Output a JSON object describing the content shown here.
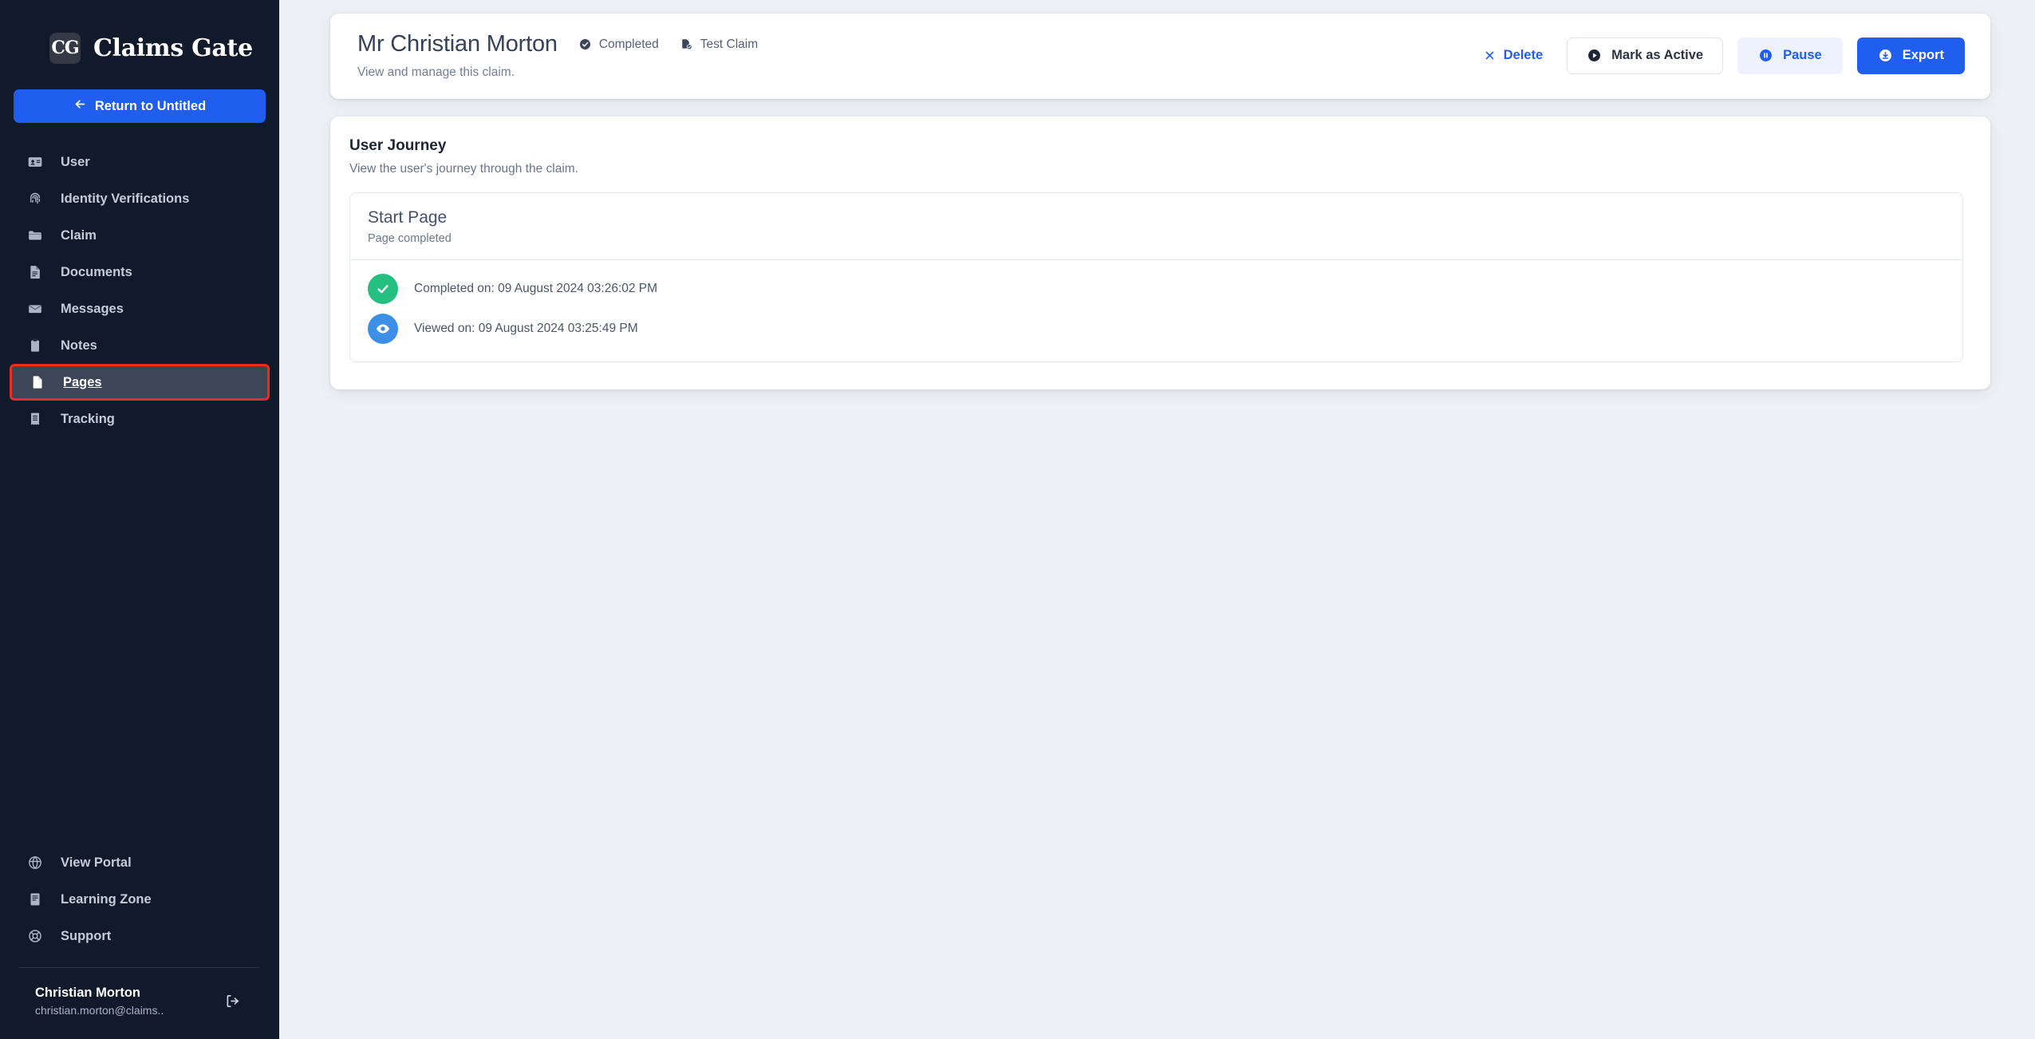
{
  "brand": {
    "logo_text": "CG",
    "name": "Claims Gate",
    "logo_icon": "claims-gate-monogram"
  },
  "sidebar": {
    "return_button": {
      "label": "Return to Untitled",
      "icon": "arrow-left-icon"
    },
    "items": [
      {
        "label": "User",
        "icon": "id-card-icon",
        "active": false
      },
      {
        "label": "Identity Verifications",
        "icon": "fingerprint-icon",
        "active": false
      },
      {
        "label": "Claim",
        "icon": "folder-icon",
        "active": false
      },
      {
        "label": "Documents",
        "icon": "document-text-icon",
        "active": false
      },
      {
        "label": "Messages",
        "icon": "envelope-icon",
        "active": false
      },
      {
        "label": "Notes",
        "icon": "clipboard-icon",
        "active": false
      },
      {
        "label": "Pages",
        "icon": "page-icon",
        "active": true
      },
      {
        "label": "Tracking",
        "icon": "receipt-icon",
        "active": false
      }
    ],
    "bottom_items": [
      {
        "label": "View Portal",
        "icon": "globe-icon"
      },
      {
        "label": "Learning Zone",
        "icon": "book-icon"
      },
      {
        "label": "Support",
        "icon": "lifebuoy-icon"
      }
    ],
    "user": {
      "name": "Christian Morton",
      "email": "christian.morton@claims..",
      "logout_icon": "logout-icon"
    }
  },
  "header": {
    "title": "Mr Christian Morton",
    "subtitle": "View and manage this claim.",
    "badges": [
      {
        "label": "Completed",
        "icon": "check-circle-icon"
      },
      {
        "label": "Test Claim",
        "icon": "test-claim-icon"
      }
    ],
    "actions": {
      "delete": {
        "label": "Delete",
        "icon": "close-x-icon"
      },
      "mark_active": {
        "label": "Mark as Active",
        "icon": "play-circle-icon"
      },
      "pause": {
        "label": "Pause",
        "icon": "pause-circle-icon"
      },
      "export": {
        "label": "Export",
        "icon": "download-circle-icon"
      }
    }
  },
  "journey": {
    "title": "User Journey",
    "subtitle": "View the user's journey through the claim.",
    "pages": [
      {
        "name": "Start Page",
        "status": "Page completed",
        "events": [
          {
            "text": "Completed on: 09 August 2024 03:26:02 PM",
            "icon": "check-icon",
            "color": "#25bf81"
          },
          {
            "text": "Viewed on: 09 August 2024 03:25:49 PM",
            "icon": "eye-icon",
            "color": "#3d8fe6"
          }
        ]
      }
    ]
  },
  "colors": {
    "sidebar_bg": "#111a2b",
    "page_bg": "#edf0f5",
    "accent_blue": "#1f5eef",
    "active_highlight_border": "#ec2b22",
    "active_highlight_bg": "#3c4657",
    "success_green": "#25bf81",
    "info_blue": "#3d8fe6"
  }
}
